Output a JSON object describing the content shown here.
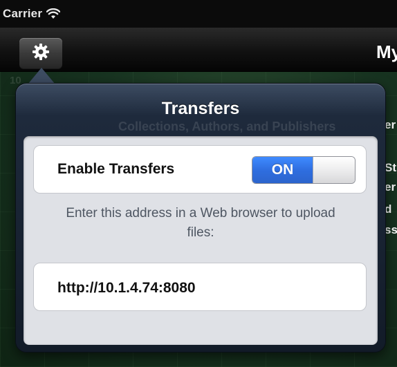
{
  "status_bar": {
    "carrier": "Carrier"
  },
  "nav_bar": {
    "title_partial": "My",
    "settings_icon": "gear-icon"
  },
  "background": {
    "ghost_text": "Collections, Authors, and Publishers",
    "side_fragments": [
      "er",
      "St",
      "er",
      "d",
      "ss"
    ],
    "tile_number": "10"
  },
  "popover": {
    "title": "Transfers",
    "toggle": {
      "label": "Enable Transfers",
      "state_label": "ON",
      "enabled": true
    },
    "hint": "Enter this address in a Web browser to upload files:",
    "address": "http://10.1.4.74:8080"
  },
  "colors": {
    "switch_on": "#2f6ee0",
    "popover_header": "#3d4c62",
    "content_bg": "#dfe1e6"
  }
}
